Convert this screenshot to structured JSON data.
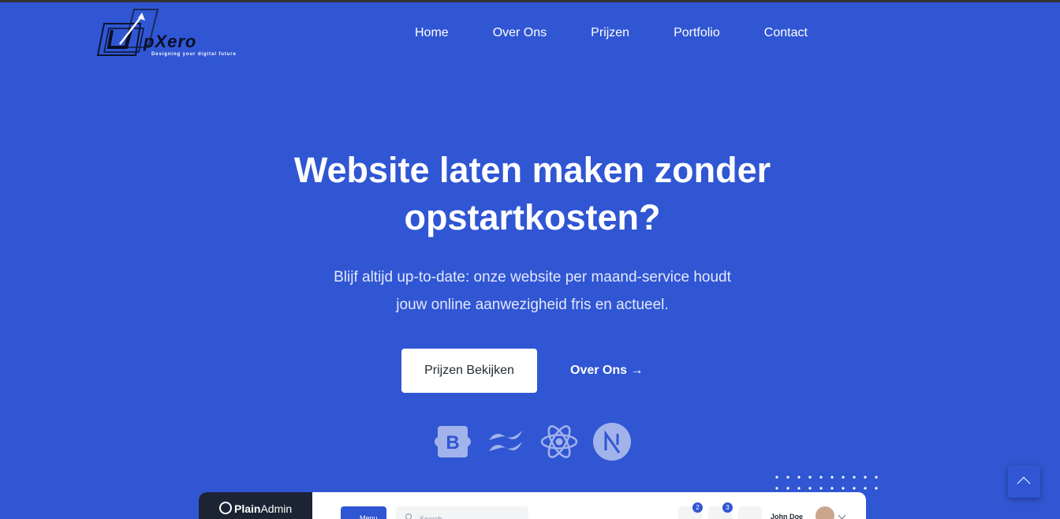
{
  "header": {
    "logo_text": "UpXero",
    "logo_tagline": "Designing your digital future",
    "nav": [
      {
        "label": "Home"
      },
      {
        "label": "Over Ons"
      },
      {
        "label": "Prijzen"
      },
      {
        "label": "Portfolio"
      },
      {
        "label": "Contact"
      }
    ]
  },
  "hero": {
    "title_line1": "Website laten maken zonder",
    "title_line2": "opstartkosten?",
    "subtitle_line1": "Blijf altijd up-to-date: onze website per maand-service houdt",
    "subtitle_line2": "jouw online aanwezigheid fris en actueel.",
    "primary_button": "Prijzen Bekijken",
    "secondary_link": "Over Ons →"
  },
  "tech_icons": [
    "bootstrap-icon",
    "tailwind-icon",
    "react-icon",
    "nextjs-icon"
  ],
  "preview": {
    "brand_bold": "Plain",
    "brand_light": "Admin",
    "menu_button": "Menu",
    "search_placeholder": "Search",
    "notification_count": "2",
    "message_count": "3",
    "user_name": "John Doe"
  },
  "colors": {
    "background": "#3056d3",
    "primary_button_bg": "#ffffff",
    "preview_sidebar": "#1c2434"
  }
}
